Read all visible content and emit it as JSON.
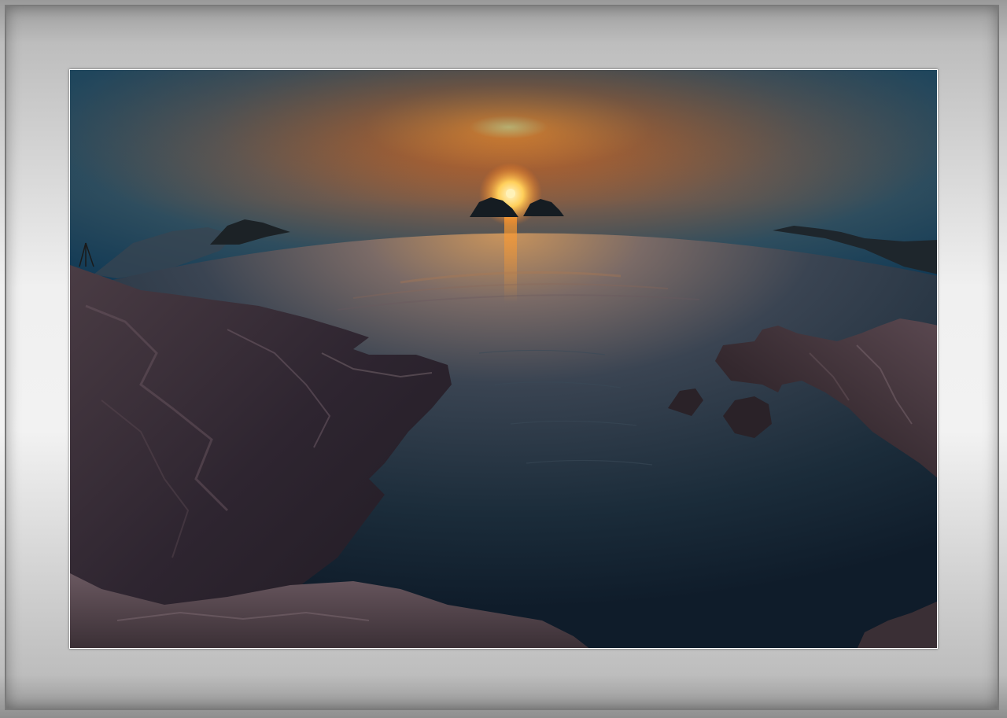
{
  "frame": {
    "mat_color": "#efefef",
    "border_color": "#7a7a7a"
  },
  "photo": {
    "subject": "sunset-over-sea",
    "sky_colors": [
      "#1c4a63",
      "#e06a1e",
      "#ffb24a"
    ],
    "water_color": "#16293a"
  }
}
